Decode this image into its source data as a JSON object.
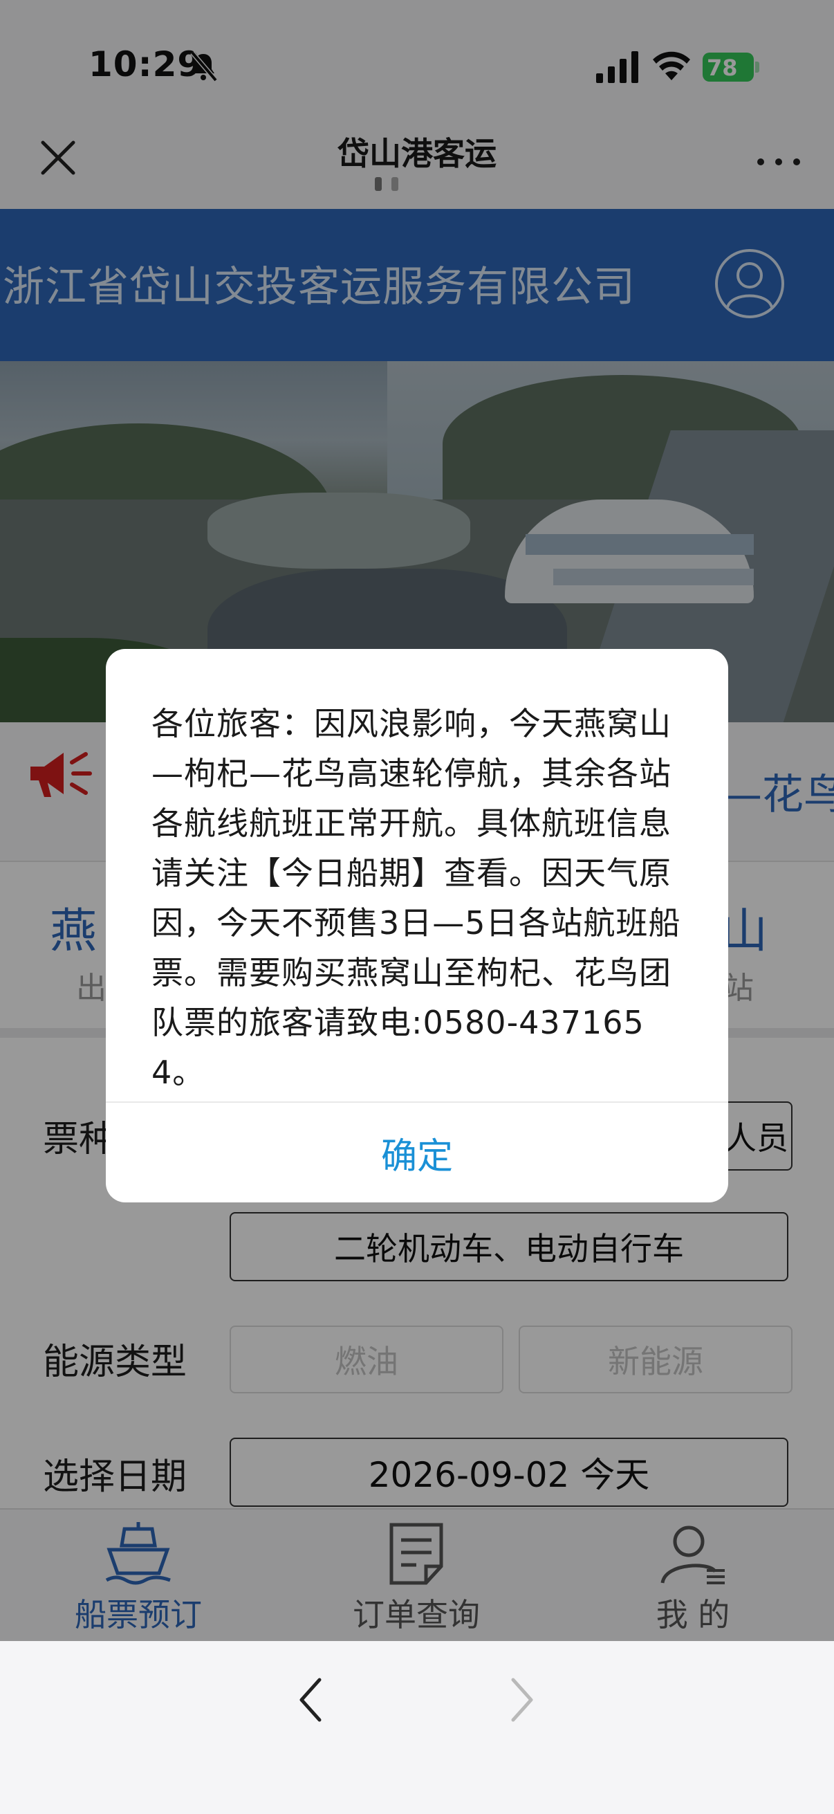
{
  "status_bar": {
    "time": "10:29",
    "battery": "78"
  },
  "nav": {
    "title": "岱山港客运"
  },
  "header": {
    "company": "浙江省岱山交投客运服务有限公司"
  },
  "notice": {
    "partial_left": "",
    "partial_text": "—花鸟"
  },
  "route": {
    "departure": {
      "name": "燕",
      "label": "出"
    },
    "arrival": {
      "name": "山",
      "label": "站"
    }
  },
  "form": {
    "ticket_label": "票种",
    "crew_option": "人员",
    "moto_option": "二轮机动车、电动自行车",
    "energy_label": "能源类型",
    "energy_options": [
      "燃油",
      "新能源"
    ],
    "date_label": "选择日期",
    "date_value": "2026-09-02 今天"
  },
  "tabs": [
    {
      "label": "船票预订",
      "icon": "ship-icon"
    },
    {
      "label": "订单查询",
      "icon": "document-icon"
    },
    {
      "label": "我 的",
      "icon": "user-icon"
    }
  ],
  "dialog": {
    "message": "各位旅客：因风浪影响，今天燕窝山—枸杞—花鸟高速轮停航，其余各站各航线航班正常开航。具体航班信息请关注【今日船期】查看。因天气原因，今天不预售3日—5日各站航班船票。需要购买燕窝山至枸杞、花鸟团队票的旅客请致电:0580-4371654。",
    "confirm": "确定"
  },
  "colors": {
    "primary": "#2d67b8",
    "link": "#1a90d6",
    "alert": "#d21f1f",
    "battery": "#34c759"
  }
}
